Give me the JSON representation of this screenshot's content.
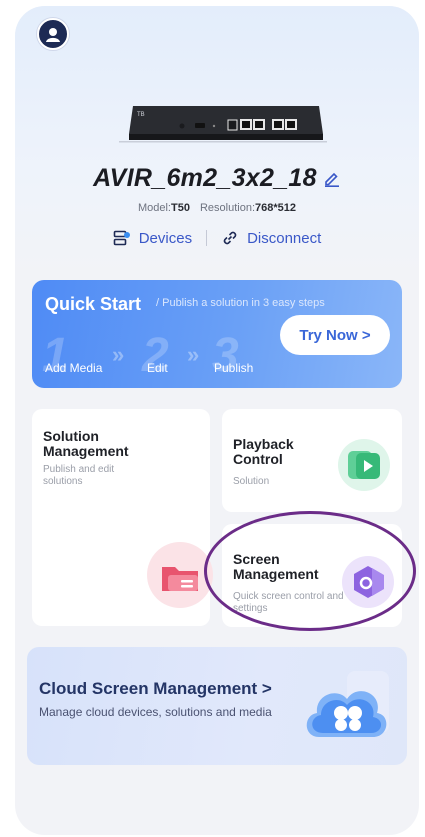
{
  "device": {
    "name": "AVIR_6m2_3x2_18",
    "model_label": "Model:",
    "model": "T50",
    "resolution_label": "Resolution:",
    "resolution": "768*512",
    "image_tag": "TB"
  },
  "actions": {
    "devices_label": "Devices",
    "disconnect_label": "Disconnect"
  },
  "quick_start": {
    "title": "Quick Start",
    "subtitle": "/ Publish a solution in 3 easy steps",
    "button_label": "Try Now >",
    "steps": [
      {
        "num": "1",
        "label": "Add Media"
      },
      {
        "num": "2",
        "label": "Edit"
      },
      {
        "num": "3",
        "label": "Publish"
      }
    ]
  },
  "cards": {
    "solution": {
      "title": "Solution Management",
      "subtitle": "Publish and edit solutions"
    },
    "playback": {
      "title": "Playback Control",
      "subtitle": "Solution"
    },
    "screen": {
      "title": "Screen Management",
      "subtitle": "Quick screen control and settings"
    }
  },
  "cloud": {
    "title": "Cloud Screen Management >",
    "subtitle": "Manage cloud devices, solutions and media"
  },
  "icons": {
    "avatar": "user-icon",
    "edit": "edit-icon",
    "devices": "devices-icon",
    "disconnect": "link-icon",
    "solution": "folder-icon",
    "playback": "play-icon",
    "screen": "hexagon-icon",
    "cloud": "cloud-icon"
  },
  "colors": {
    "accent": "#3a58c8",
    "quick_start_bg": "#4f8bf5",
    "highlight": "#6b2c88"
  }
}
